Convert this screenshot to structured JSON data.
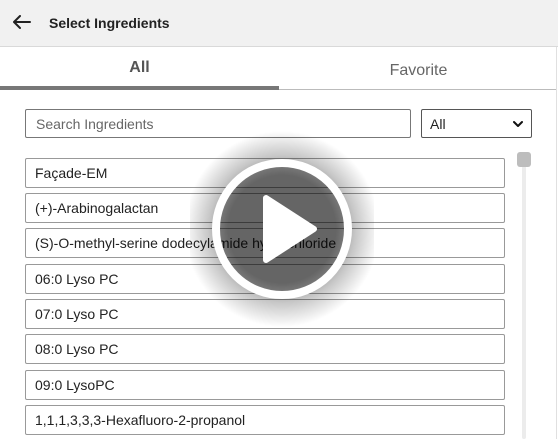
{
  "header": {
    "title": "Select Ingredients",
    "back_icon": "arrow-left-icon"
  },
  "tabs": [
    {
      "label": "All",
      "active": true
    },
    {
      "label": "Favorite",
      "active": false
    }
  ],
  "search": {
    "placeholder": "Search Ingredients",
    "value": ""
  },
  "filter": {
    "selected": "All"
  },
  "ingredients": [
    {
      "name": "Façade-EM"
    },
    {
      "name": "(+)-Arabinogalactan"
    },
    {
      "name": "(S)-O-methyl-serine dodecylamide hydrochloride"
    },
    {
      "name": "06:0 Lyso PC"
    },
    {
      "name": "07:0 Lyso PC"
    },
    {
      "name": "08:0 Lyso PC"
    },
    {
      "name": "09:0 LysoPC"
    },
    {
      "name": "1,1,1,3,3,3-Hexafluoro-2-propanol"
    }
  ],
  "video_overlay": {
    "icon": "play-icon"
  },
  "colors": {
    "header_bg": "#f1f1f1",
    "tab_indicator": "#777777",
    "item_border": "#999999"
  }
}
